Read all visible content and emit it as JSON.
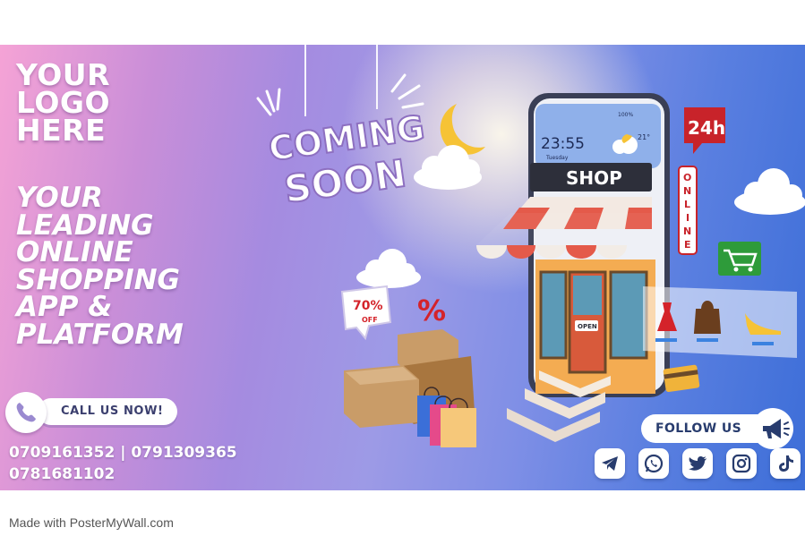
{
  "logo": {
    "line1": "YOUR",
    "line2": "LOGO",
    "line3": "HERE"
  },
  "tagline": {
    "line1": "YOUR",
    "line2": "LEADING",
    "line3": "ONLINE",
    "line4": "SHOPPING",
    "line5": "APP &",
    "line6": "PLATFORM"
  },
  "call": {
    "label": "CALL US NOW!"
  },
  "phones": {
    "line1": "0709161352 | 0791309365",
    "line2": "0781681102"
  },
  "coming_soon": {
    "line1": "COMING",
    "line2": "SOON"
  },
  "phone_screen": {
    "time": "23:55",
    "day": "Tuesday",
    "battery": "100%",
    "temp": "21°"
  },
  "shop_sign": "SHOP",
  "open_sign": "OPEN",
  "badge_24h": "24h",
  "online_sign": [
    "O",
    "N",
    "L",
    "I",
    "N",
    "E"
  ],
  "discount": {
    "value": "70%",
    "label": "OFF"
  },
  "percent_symbol": "%",
  "follow": {
    "label": "FOLLOW US"
  },
  "social_icons": [
    "telegram-icon",
    "whatsapp-icon",
    "twitter-icon",
    "instagram-icon",
    "tiktok-icon"
  ],
  "footer": {
    "text": "Made with PosterMyWall.com"
  },
  "colors": {
    "accent_red": "#d4232a",
    "navy": "#283c6e",
    "cart_green": "#2e9b3a"
  }
}
